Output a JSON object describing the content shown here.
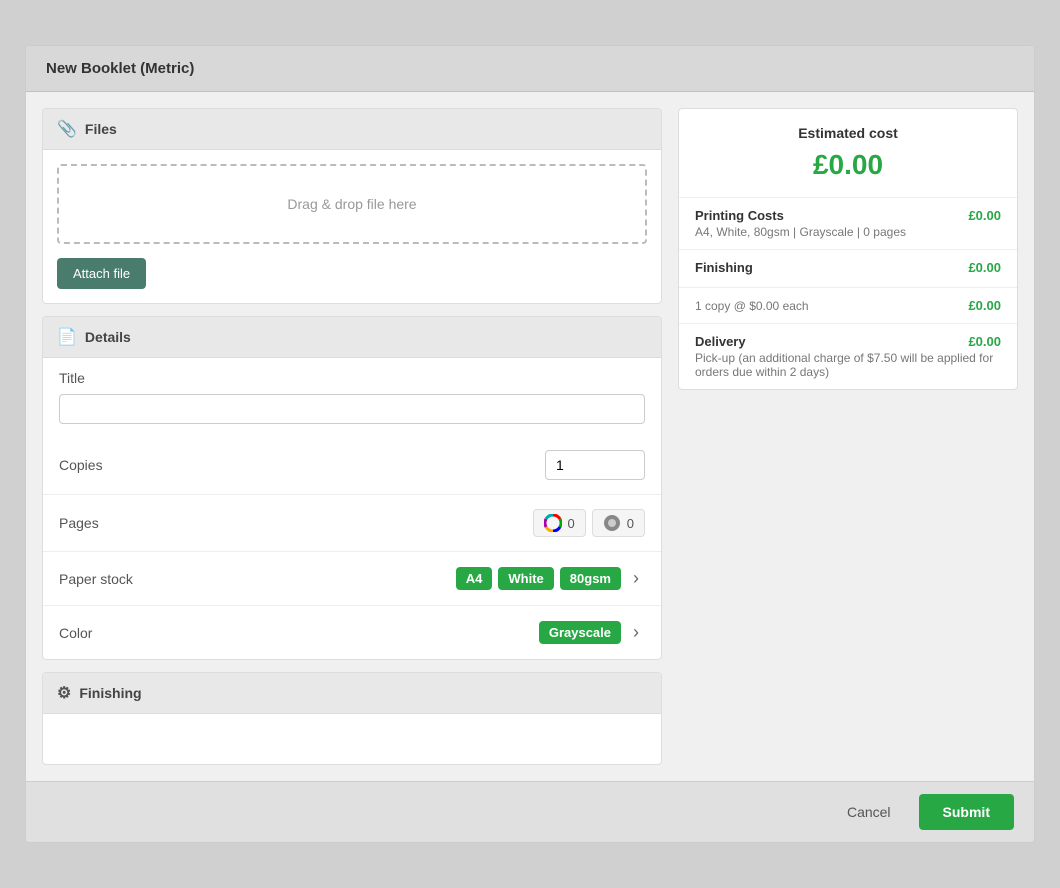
{
  "modal": {
    "title": "New Booklet (Metric)"
  },
  "files": {
    "section_title": "Files",
    "dropzone_text": "Drag & drop file here",
    "attach_button": "Attach file"
  },
  "details": {
    "section_title": "Details",
    "title_label": "Title",
    "title_placeholder": "",
    "copies_label": "Copies",
    "copies_value": "1",
    "pages_label": "Pages",
    "color_pages_count": "0",
    "bw_pages_count": "0",
    "paper_stock_label": "Paper stock",
    "paper_stock_size": "A4",
    "paper_stock_color": "White",
    "paper_stock_weight": "80gsm",
    "color_label": "Color",
    "color_value": "Grayscale"
  },
  "finishing": {
    "section_title": "Finishing"
  },
  "estimated_cost": {
    "title": "Estimated cost",
    "amount": "£0.00",
    "printing_costs_label": "Printing Costs",
    "printing_costs_value": "£0.00",
    "printing_costs_sub": "A4, White, 80gsm | Grayscale | 0 pages",
    "finishing_label": "Finishing",
    "finishing_value": "£0.00",
    "copy_label": "1 copy @ $0.00 each",
    "copy_value": "£0.00",
    "delivery_label": "Delivery",
    "delivery_value": "£0.00",
    "delivery_sub": "Pick-up (an additional charge of $7.50 will be applied for orders due within 2 days)"
  },
  "footer": {
    "cancel_label": "Cancel",
    "submit_label": "Submit"
  },
  "icons": {
    "paperclip": "📎",
    "document": "📄",
    "sliders": "⚙"
  }
}
